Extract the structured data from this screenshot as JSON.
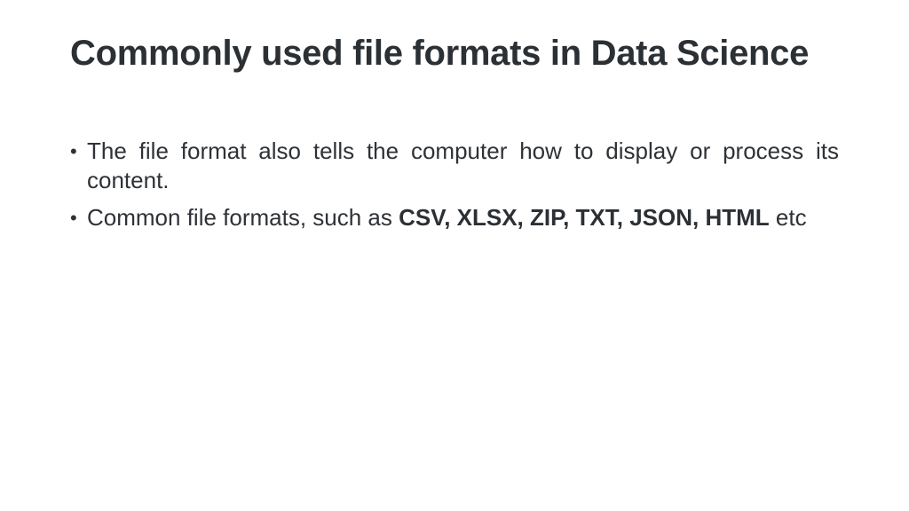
{
  "slide": {
    "title": "Commonly used file formats in Data Science",
    "bullets": [
      {
        "text": "The file format also tells the computer how to display or process its content."
      },
      {
        "prefix": "Common file formats, such as ",
        "bold": "CSV, XLSX, ZIP, TXT, JSON, HTML",
        "suffix": " etc"
      }
    ],
    "bullet_glyph": "•",
    "colors": {
      "title": "#2b3035",
      "body": "#2e3237",
      "background": "#ffffff"
    }
  }
}
